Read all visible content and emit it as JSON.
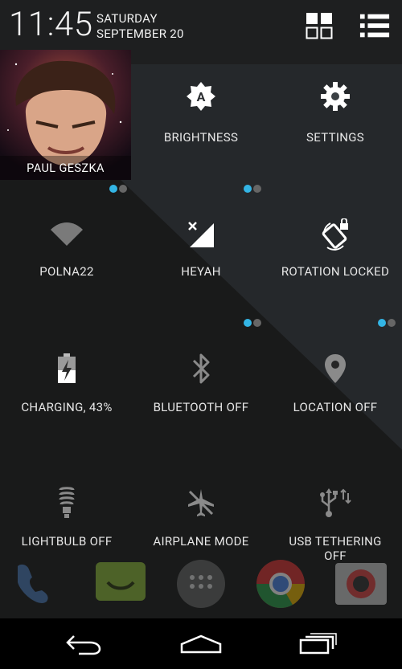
{
  "status": {
    "time": "11:45",
    "day": "SATURDAY",
    "date": "SEPTEMBER 20"
  },
  "user": {
    "name": "PAUL GESZKA"
  },
  "tiles": {
    "brightness": "BRIGHTNESS",
    "settings": "SETTINGS",
    "wifi": "POLNA22",
    "mobile": "HEYAH",
    "rotation": "ROTATION LOCKED",
    "battery": "CHARGING, 43%",
    "bluetooth": "BLUETOOTH OFF",
    "location": "LOCATION OFF",
    "lightbulb": "LIGHTBULB OFF",
    "airplane": "AIRPLANE MODE",
    "usb_line1": "USB TETHERING",
    "usb_line2": "OFF"
  },
  "colors": {
    "accent": "#33b5e5",
    "nav_background": "#000000"
  }
}
